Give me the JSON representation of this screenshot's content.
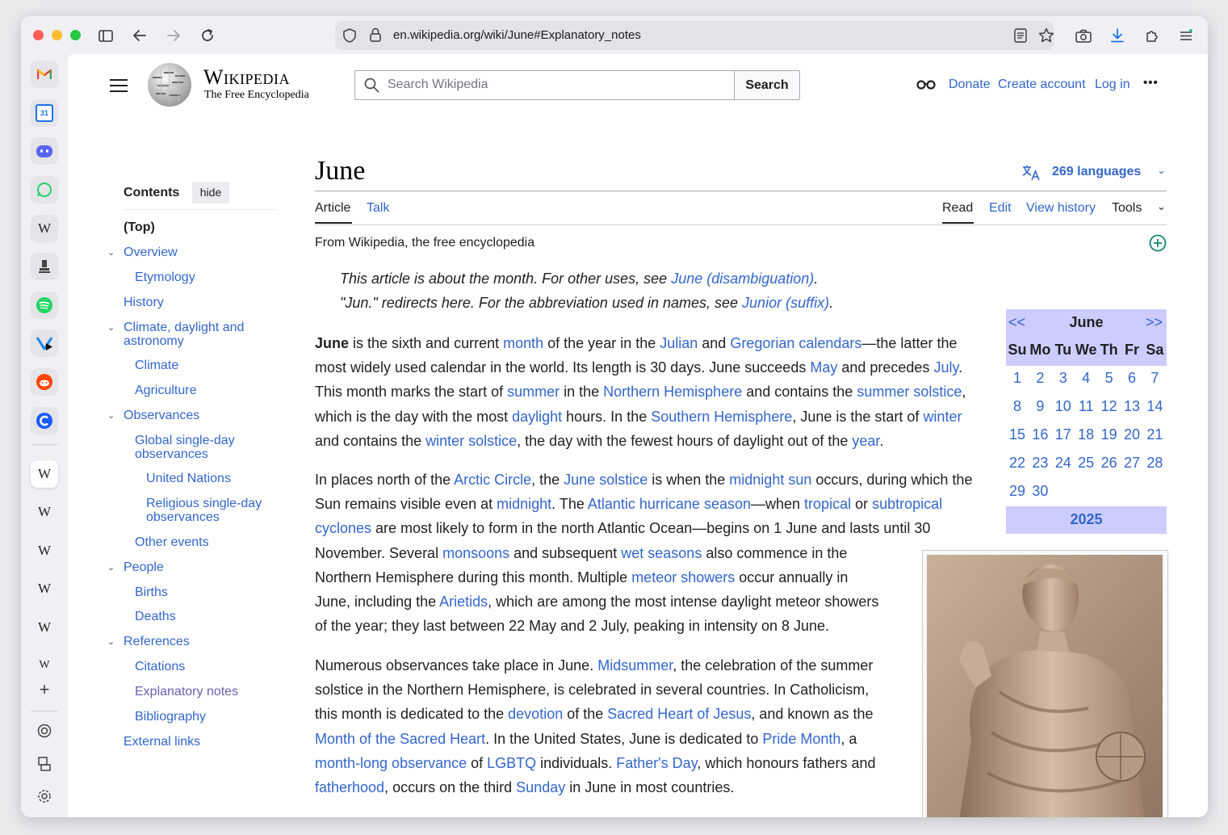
{
  "browser": {
    "url": "en.wikipedia.org/wiki/June#Explanatory_notes",
    "icons": [
      "back-icon",
      "forward-icon",
      "reload-icon",
      "shield-icon",
      "lock-icon",
      "reader-icon",
      "star-icon",
      "camera-icon",
      "download-icon",
      "extensions-icon",
      "menu-icon"
    ]
  },
  "sidebar": {
    "apps": [
      "gmail",
      "calendar",
      "discord",
      "whatsapp",
      "wikipedia",
      "app",
      "spotify",
      "app",
      "reddit",
      "app"
    ],
    "calendar_day": "31",
    "wiki_glyph": "W",
    "add_glyph": "+"
  },
  "header": {
    "logo_title": "Wikipedia",
    "logo_subtitle": "The Free Encyclopedia",
    "search_placeholder": "Search Wikipedia",
    "search_button": "Search",
    "donate": "Donate",
    "create_account": "Create account",
    "log_in": "Log in",
    "more": "•••"
  },
  "toc": {
    "title": "Contents",
    "hide": "hide",
    "items": [
      "(Top)",
      "Overview",
      "Etymology",
      "History",
      "Climate, daylight and astronomy",
      "Climate",
      "Agriculture",
      "Observances",
      "Global single-day observances",
      "United Nations",
      "Religious single-day observances",
      "Other events",
      "People",
      "Births",
      "Deaths",
      "References",
      "Citations",
      "Explanatory notes",
      "Bibliography",
      "External links"
    ]
  },
  "article": {
    "title": "June",
    "languages": "269 languages",
    "tabs": {
      "article": "Article",
      "talk": "Talk",
      "read": "Read",
      "edit": "Edit",
      "history": "View history",
      "tools": "Tools"
    },
    "from": "From Wikipedia, the free encyclopedia",
    "hatnote1_pre": "This article is about the month. For other uses, see ",
    "hatnote1_link": "June (disambiguation)",
    "hatnote1_post": ".",
    "hatnote2_pre": "\"Jun.\" redirects here. For the abbreviation used in names, see ",
    "hatnote2_link": "Junior (suffix)",
    "hatnote2_post": "."
  },
  "calendar": {
    "prev": "<<",
    "month": "June",
    "next": ">>",
    "days": [
      "Su",
      "Mo",
      "Tu",
      "We",
      "Th",
      "Fr",
      "Sa"
    ],
    "weeks": [
      [
        "1",
        "2",
        "3",
        "4",
        "5",
        "6",
        "7"
      ],
      [
        "8",
        "9",
        "10",
        "11",
        "12",
        "13",
        "14"
      ],
      [
        "15",
        "16",
        "17",
        "18",
        "19",
        "20",
        "21"
      ],
      [
        "22",
        "23",
        "24",
        "25",
        "26",
        "27",
        "28"
      ],
      [
        "29",
        "30",
        "",
        "",
        "",
        "",
        ""
      ]
    ],
    "year": "2025"
  },
  "paragraphs": [
    [
      [
        [
          "June",
          "b"
        ],
        [
          " is the sixth and current "
        ],
        [
          "month",
          "a"
        ],
        [
          " of the year in the "
        ],
        [
          "Julian",
          "a"
        ],
        [
          " and "
        ],
        [
          "Gregorian calendars",
          "a"
        ],
        [
          "—the latter the"
        ]
      ],
      [
        [
          "most widely used calendar in the world. Its length is 30 days. June succeeds "
        ],
        [
          "May",
          "a"
        ],
        [
          " and precedes "
        ],
        [
          "July",
          "a"
        ],
        [
          "."
        ]
      ],
      [
        [
          "This month marks the start of "
        ],
        [
          "summer",
          "a"
        ],
        [
          " in the "
        ],
        [
          "Northern Hemisphere",
          "a"
        ],
        [
          " and contains the "
        ],
        [
          "summer solstice",
          "a"
        ],
        [
          ","
        ]
      ],
      [
        [
          "which is the day with the most "
        ],
        [
          "daylight",
          "a"
        ],
        [
          " hours. In the "
        ],
        [
          "Southern Hemisphere",
          "a"
        ],
        [
          ", June is the start of "
        ],
        [
          "winter",
          "a"
        ]
      ],
      [
        [
          "and contains the "
        ],
        [
          "winter solstice",
          "a"
        ],
        [
          ", the day with the fewest hours of daylight out of the "
        ],
        [
          "year",
          "a"
        ],
        [
          "."
        ]
      ]
    ],
    [
      [
        [
          "In places north of the "
        ],
        [
          "Arctic Circle",
          "a"
        ],
        [
          ", the "
        ],
        [
          "June solstice",
          "a"
        ],
        [
          " is when the "
        ],
        [
          "midnight sun",
          "a"
        ],
        [
          " occurs, during which the"
        ]
      ],
      [
        [
          "Sun remains visible even at "
        ],
        [
          "midnight",
          "a"
        ],
        [
          ". The "
        ],
        [
          "Atlantic hurricane season",
          "a"
        ],
        [
          "—when "
        ],
        [
          "tropical",
          "a"
        ],
        [
          " or "
        ],
        [
          "subtropical",
          "a"
        ]
      ],
      [
        [
          "cyclones",
          "a"
        ],
        [
          " are most likely to form in the north Atlantic Ocean—begins on 1 June and lasts until 30"
        ]
      ],
      [
        [
          "November. Several "
        ],
        [
          "monsoons",
          "a"
        ],
        [
          " and subsequent "
        ],
        [
          "wet seasons",
          "a"
        ],
        [
          " also commence in the"
        ]
      ],
      [
        [
          "Northern Hemisphere during this month. Multiple "
        ],
        [
          "meteor showers",
          "a"
        ],
        [
          " occur annually in"
        ]
      ],
      [
        [
          "June, including the "
        ],
        [
          "Arietids",
          "a"
        ],
        [
          ", which are among the most intense daylight meteor showers"
        ]
      ],
      [
        [
          "of the year; they last between 22 May and 2 July, peaking in intensity on 8 June."
        ]
      ]
    ],
    [
      [
        [
          "Numerous observances take place in June. "
        ],
        [
          "Midsummer",
          "a"
        ],
        [
          ", the celebration of the summer"
        ]
      ],
      [
        [
          "solstice in the Northern Hemisphere, is celebrated in several countries. In Catholicism,"
        ]
      ],
      [
        [
          "this month is dedicated to the "
        ],
        [
          "devotion",
          "a"
        ],
        [
          " of the "
        ],
        [
          "Sacred Heart of Jesus",
          "a"
        ],
        [
          ", and known as the"
        ]
      ],
      [
        [
          "Month of the Sacred Heart",
          "a"
        ],
        [
          ". In the United States, June is dedicated to "
        ],
        [
          "Pride Month",
          "a"
        ],
        [
          ", a"
        ]
      ],
      [
        [
          "month-long observance",
          "a"
        ],
        [
          " of "
        ],
        [
          "LGBTQ",
          "a"
        ],
        [
          " individuals. "
        ],
        [
          "Father's Day",
          "a"
        ],
        [
          ", which honours fathers and"
        ]
      ],
      [
        [
          "fatherhood",
          "a"
        ],
        [
          ", occurs on the third "
        ],
        [
          "Sunday",
          "a"
        ],
        [
          " in June in most countries."
        ]
      ]
    ]
  ],
  "colors": {
    "link": "#3366cc",
    "calendar_header": "#ccccff",
    "text": "#202122"
  }
}
